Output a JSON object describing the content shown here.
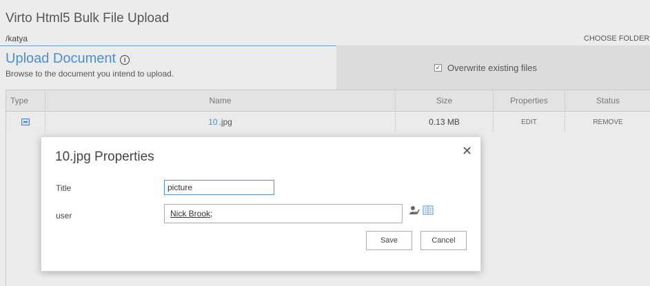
{
  "app": {
    "title": "Virto Html5 Bulk File Upload"
  },
  "folder": {
    "path": "/katya",
    "choose_label": "CHOOSE FOLDER"
  },
  "upload": {
    "title": "Upload Document",
    "info_icon": "info-icon",
    "description": "Browse to the document you intend to upload."
  },
  "options": {
    "overwrite_label": "Overwrite existing files",
    "overwrite_checked": true
  },
  "table": {
    "headers": {
      "type": "Type",
      "name": "Name",
      "size": "Size",
      "properties": "Properties",
      "status": "Status"
    },
    "rows": [
      {
        "type_icon": "image-file-icon",
        "name_base": "10",
        "name_ext": " .jpg",
        "size": "0.13 MB",
        "properties_action": "EDIT",
        "status_action": "REMOVE"
      }
    ]
  },
  "dialog": {
    "title": "10.jpg Properties",
    "close_icon": "close-icon",
    "fields": {
      "title_label": "Title",
      "title_value": "picture",
      "user_label": "user",
      "user_value": "Nick Brook",
      "user_suffix": ";"
    },
    "icons": [
      "check-names-icon",
      "browse-icon"
    ],
    "buttons": {
      "save": "Save",
      "cancel": "Cancel"
    }
  },
  "colors": {
    "accent": "#4b8fd0",
    "background": "#ececec",
    "panel": "#dcdcdc"
  }
}
